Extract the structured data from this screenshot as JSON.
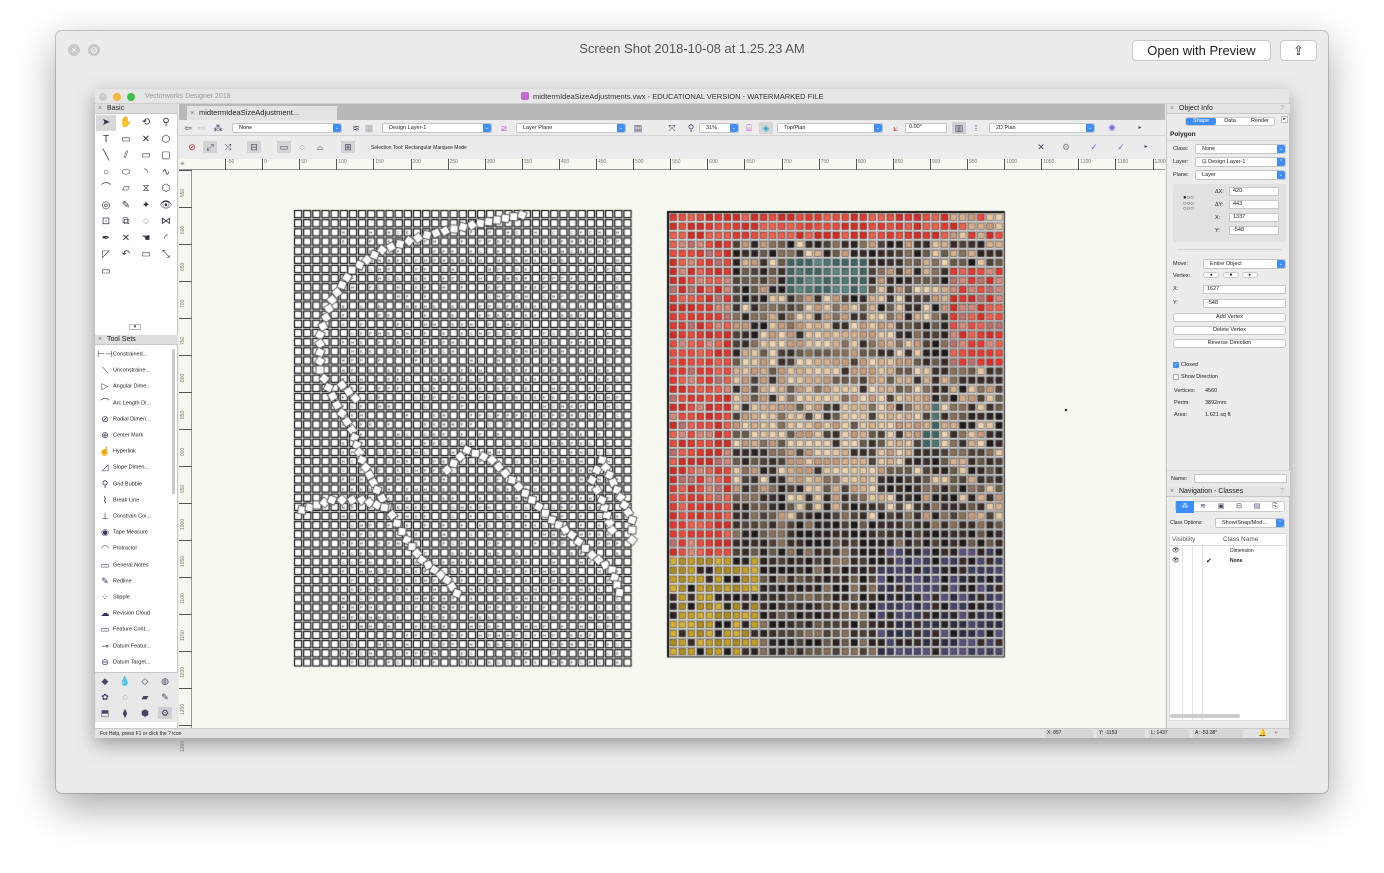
{
  "preview": {
    "title": "Screen Shot 2018-10-08 at 1.25.23 AM",
    "open_button": "Open with Preview",
    "share_icon": "share-icon"
  },
  "app": {
    "name": "Vectorworks Designer 2018",
    "doc_title": "midtermIdeaSizeAdjustments.vwx - EDUCATIONAL VERSION - WATERMARKED FILE",
    "tab": "midtermIdeaSizeAdjustment..."
  },
  "view_bar": {
    "class": "None",
    "layer": "Design Layer-1",
    "plane": "Layer Plane",
    "zoom": "31%",
    "view": "Top/Plan",
    "rotation": "0.00°",
    "render": "2D Plan"
  },
  "mode_bar": {
    "message": "Selection Tool: Rectangular Marquee Mode"
  },
  "rulers": {
    "h": [
      "-50",
      "0",
      "50",
      "100",
      "150",
      "200",
      "250",
      "300",
      "350",
      "400",
      "450",
      "500",
      "550",
      "600",
      "650",
      "700",
      "750",
      "800",
      "850",
      "900",
      "950",
      "1000",
      "1050",
      "1100",
      "1150",
      "1200",
      "1250"
    ],
    "v": [
      "550",
      "600",
      "650",
      "700",
      "750",
      "800",
      "850",
      "900",
      "950",
      "1000",
      "1050",
      "1100",
      "1150",
      "1200",
      "1250",
      "1300"
    ]
  },
  "basic": {
    "title": "Basic",
    "tools": [
      "selection",
      "pan",
      "flyover",
      "zoom",
      "text",
      "callout",
      "locus",
      "3d-locus",
      "line",
      "double-line",
      "rectangle",
      "rounded-rectangle",
      "circle",
      "oval",
      "arc",
      "freehand",
      "polyline",
      "polygon",
      "double-polygon",
      "regular-polygon",
      "spiral",
      "eyedropper",
      "attribute-mapping",
      "visibility",
      "reshape",
      "clip",
      "rotate",
      "mirror",
      "offset",
      "split",
      "connect",
      "fillet",
      "chamfer",
      "fillet-2",
      "eraser",
      "trim",
      "wall"
    ]
  },
  "tool_sets": {
    "title": "Tool Sets",
    "items": [
      {
        "label": "Constrained...",
        "icon": "⊢⊣"
      },
      {
        "label": "Unconstraine...",
        "icon": "⟍"
      },
      {
        "label": "Angular Dime...",
        "icon": "▷"
      },
      {
        "label": "Arc Length Di...",
        "icon": "⌒"
      },
      {
        "label": "Radial Dimen...",
        "icon": "⊘"
      },
      {
        "label": "Center Mark",
        "icon": "⊕"
      },
      {
        "label": "Hyperlink",
        "icon": "☝"
      },
      {
        "label": "Slope Dimen...",
        "icon": "◿"
      },
      {
        "label": "Grid Bubble",
        "icon": "⚲"
      },
      {
        "label": "Break Line",
        "icon": "⌇"
      },
      {
        "label": "Constrain Coi...",
        "icon": "⊥"
      },
      {
        "label": "Tape Measure",
        "icon": "◉"
      },
      {
        "label": "Protractor",
        "icon": "◠"
      },
      {
        "label": "General Notes",
        "icon": "▭"
      },
      {
        "label": "Redline",
        "icon": "✎"
      },
      {
        "label": "Stipple",
        "icon": "⁘"
      },
      {
        "label": "Revision Cloud",
        "icon": "☁"
      },
      {
        "label": "Feature Cont...",
        "icon": "▭"
      },
      {
        "label": "Datum Featur...",
        "icon": "⊸"
      },
      {
        "label": "Datum Target...",
        "icon": "⊖"
      }
    ]
  },
  "object_info": {
    "title": "Object Info",
    "tabs": [
      "Shape",
      "Data",
      "Render"
    ],
    "active_tab": "Shape",
    "type": "Polygon",
    "class_label": "Class:",
    "class": "None",
    "layer_label": "Layer:",
    "layer": "Design Layer-1",
    "plane_label": "Plane:",
    "plane": "Layer",
    "dx_label": "ΔX:",
    "dx": "420",
    "dy_label": "ΔY:",
    "dy": "443",
    "x_label": "X:",
    "x": "1337",
    "y_label": "Y:",
    "y": "-548",
    "move_label": "Move:",
    "move": "Entire Object",
    "vertex_label": "Vertex:",
    "vx_label": "X:",
    "vx": "1627",
    "vy_label": "Y:",
    "vy": "-548",
    "add_vertex": "Add Vertex",
    "delete_vertex": "Delete Vertex",
    "reverse": "Reverse Direction",
    "closed": "Closed",
    "closed_checked": true,
    "show_direction": "Show Direction",
    "show_direction_checked": false,
    "vertices_label": "Vertices:",
    "vertices": "4560",
    "perim_label": "Perim:",
    "perim": "3892mm",
    "area_label": "Area:",
    "area": "1.621 sq ft",
    "name_label": "Name:",
    "name": ""
  },
  "navigation": {
    "title": "Navigation - Classes",
    "class_options_label": "Class Options:",
    "class_options": "Show/Snap/Mod...",
    "col_visibility": "Visibility",
    "col_class_name": "Class Name",
    "rows": [
      {
        "name": "Dimension",
        "active": false
      },
      {
        "name": "None",
        "active": true
      }
    ]
  },
  "status": {
    "help": "For Help, press F1 or click the ? icon",
    "x": "X: 857",
    "y": "Y: -1153",
    "l": "L: 1437",
    "a": "A: -53.38°"
  }
}
